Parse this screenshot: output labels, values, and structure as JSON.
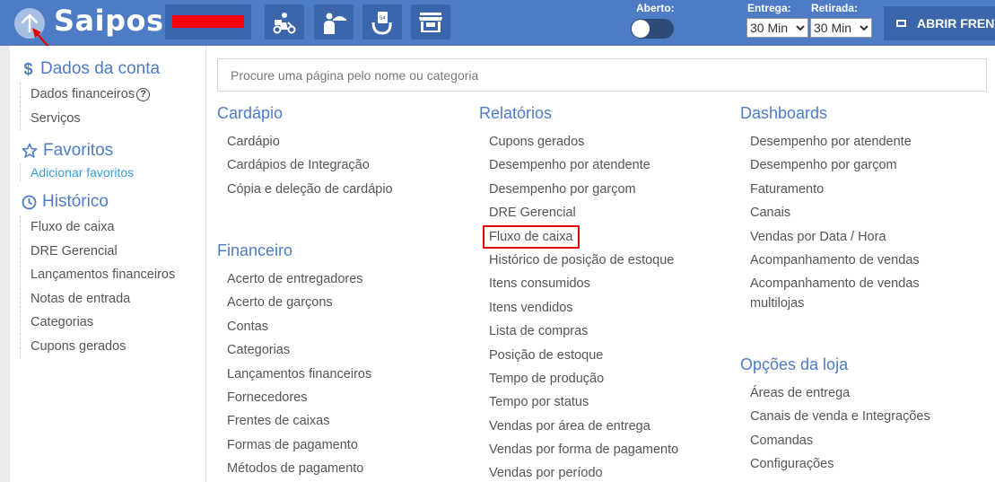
{
  "header": {
    "logo_text": "Saipos",
    "status_label": "Aberto:",
    "delivery_label": "Entrega:",
    "delivery_time": "30 Min",
    "pickup_label": "Retirada:",
    "pickup_time": "30 Min",
    "open_front_label": "ABRIR FRENTE"
  },
  "colors": {
    "brand_blue": "#4e7cc4",
    "dark_blue": "#3b66ab",
    "highlight_red": "#e00000",
    "link_blue": "#3a9de0"
  },
  "sidebar": {
    "account": {
      "title": "Dados da conta",
      "icon": "dollar-icon",
      "items": [
        "Dados financeiros",
        "Serviços"
      ]
    },
    "favorites": {
      "title": "Favoritos",
      "icon": "star-icon",
      "add_link": "Adicionar favoritos"
    },
    "history": {
      "title": "Histórico",
      "icon": "clock-icon",
      "items": [
        "Fluxo de caixa",
        "DRE Gerencial",
        "Lançamentos financeiros",
        "Notas de entrada",
        "Categorias",
        "Cupons gerados"
      ]
    }
  },
  "search": {
    "placeholder": "Procure uma página pelo nome ou categoria"
  },
  "categories": {
    "cardapio": {
      "title": "Cardápio",
      "items": [
        "Cardápio",
        "Cardápios de Integração",
        "Cópia e deleção de cardápio"
      ]
    },
    "financeiro": {
      "title": "Financeiro",
      "items": [
        "Acerto de entregadores",
        "Acerto de garçons",
        "Contas",
        "Categorias",
        "Lançamentos financeiros",
        "Fornecedores",
        "Frentes de caixas",
        "Formas de pagamento",
        "Métodos de pagamento"
      ]
    },
    "relatorios": {
      "title": "Relatórios",
      "items": [
        "Cupons gerados",
        "Desempenho por atendente",
        "Desempenho por garçom",
        "DRE Gerencial",
        "Fluxo de caixa",
        "Histórico de posição de estoque",
        "Itens consumidos",
        "Itens vendidos",
        "Lista de compras",
        "Posição de estoque",
        "Tempo de produção",
        "Tempo por status",
        "Vendas por área de entrega",
        "Vendas por forma de pagamento",
        "Vendas por período"
      ]
    },
    "dashboards": {
      "title": "Dashboards",
      "items": [
        "Desempenho por atendente",
        "Desempenho por garçom",
        "Faturamento",
        "Canais",
        "Vendas por Data / Hora",
        "Acompanhamento de vendas",
        "Acompanhamento de vendas multilojas"
      ]
    },
    "opcoes": {
      "title": "Opções da loja",
      "items": [
        "Áreas de entrega",
        "Canais de venda e Integrações",
        "Comandas",
        "Configurações"
      ]
    }
  }
}
